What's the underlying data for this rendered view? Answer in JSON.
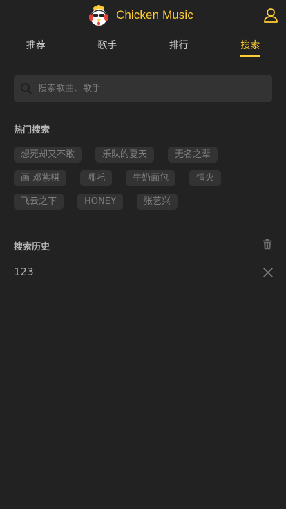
{
  "app": {
    "title": "Chicken Music",
    "accent_color": "#ffcd32",
    "background_color": "#222222",
    "logo_icon": "chicken-logo-icon",
    "user_icon": "user-icon"
  },
  "tabs": [
    {
      "label": "推荐",
      "active": false
    },
    {
      "label": "歌手",
      "active": false
    },
    {
      "label": "排行",
      "active": false
    },
    {
      "label": "搜索",
      "active": true
    }
  ],
  "search": {
    "placeholder": "搜索歌曲、歌手",
    "value": "",
    "icon": "search-icon"
  },
  "hot_search": {
    "title": "热门搜索",
    "items": [
      "想死却又不敢",
      "乐队的夏天",
      "无名之辈",
      "画 邓紫棋",
      "哪吒",
      "牛奶面包",
      "情火",
      "飞云之下",
      "HONEY",
      "张艺兴"
    ]
  },
  "history": {
    "title": "搜索历史",
    "clear_icon": "trash-icon",
    "delete_icon": "close-icon",
    "items": [
      "123"
    ]
  }
}
